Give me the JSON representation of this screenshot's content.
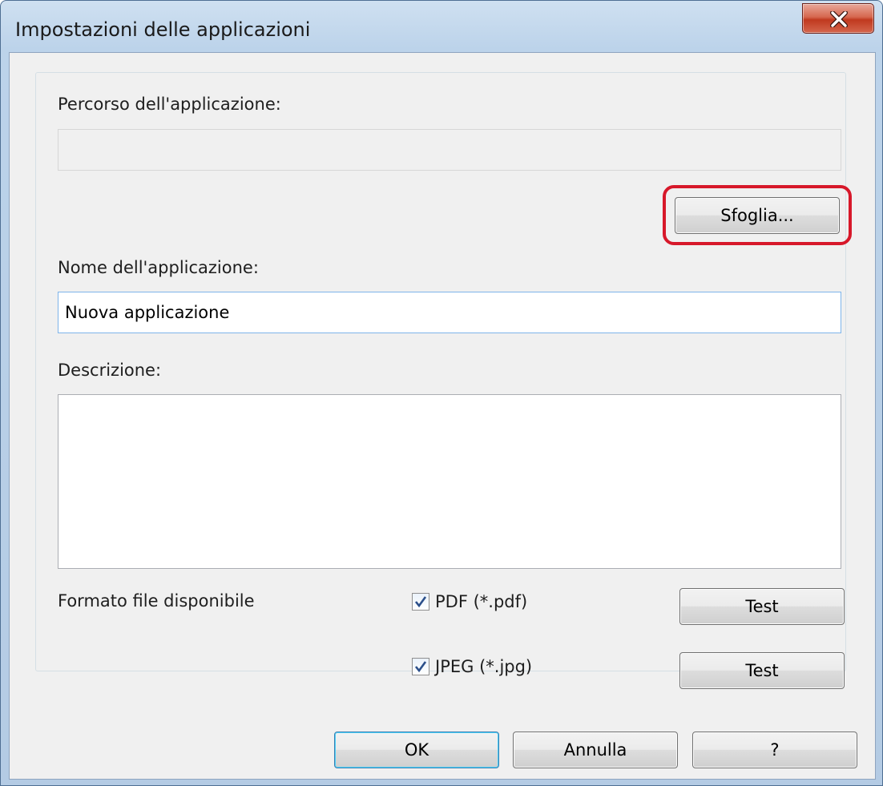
{
  "window": {
    "title": "Impostazioni delle applicazioni",
    "close_icon": "close-x-icon"
  },
  "form": {
    "path_label": "Percorso dell'applicazione:",
    "path_value": "",
    "browse_button": "Sfoglia...",
    "name_label": "Nome dell'applicazione:",
    "name_value": "Nuova applicazione",
    "description_label": "Descrizione:",
    "description_value": "",
    "formats_label": "Formato file disponibile",
    "formats": [
      {
        "label": "PDF (*.pdf)",
        "checked": true,
        "test_button": "Test"
      },
      {
        "label": "JPEG (*.jpg)",
        "checked": true,
        "test_button": "Test"
      }
    ]
  },
  "footer": {
    "ok_button": "OK",
    "cancel_button": "Annulla",
    "help_button": "?"
  },
  "colors": {
    "highlight": "#d7182a",
    "close_button": "#c0391f",
    "check_mark": "#2b4f8a"
  }
}
